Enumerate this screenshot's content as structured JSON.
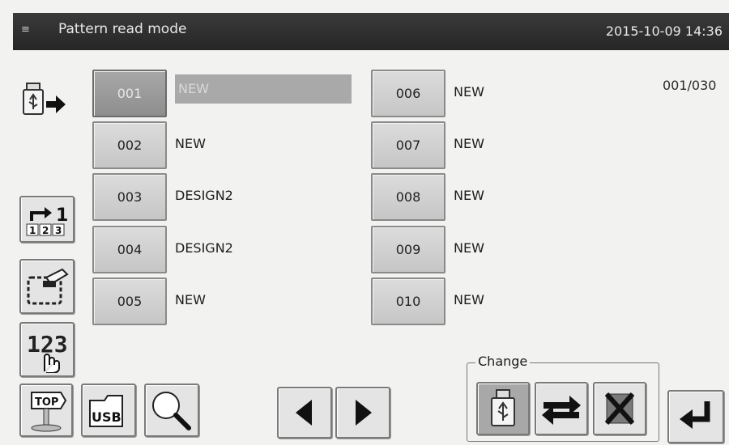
{
  "header": {
    "title": "Pattern read mode",
    "datetime": "2015-10-09 14:36"
  },
  "counter": "001/030",
  "patterns": [
    {
      "number": "001",
      "name": "NEW",
      "selected": true
    },
    {
      "number": "002",
      "name": "NEW"
    },
    {
      "number": "003",
      "name": "DESIGN2"
    },
    {
      "number": "004",
      "name": "DESIGN2"
    },
    {
      "number": "005",
      "name": "NEW"
    },
    {
      "number": "006",
      "name": "NEW"
    },
    {
      "number": "007",
      "name": "NEW"
    },
    {
      "number": "008",
      "name": "NEW"
    },
    {
      "number": "009",
      "name": "NEW"
    },
    {
      "number": "010",
      "name": "NEW"
    }
  ],
  "toolbar": {
    "top_label": "TOP",
    "usb_label": "USB"
  },
  "change": {
    "label": "Change"
  },
  "icons": {
    "usb_read": "usb-arrow-icon",
    "number_order": "arrow-123-icon",
    "copy": "copy-pattern-icon",
    "number_touch": "123-hand-icon",
    "top": "top-sign-icon",
    "usb": "usb-folder-icon",
    "search": "magnifier-icon",
    "prev": "triangle-left-icon",
    "next": "triangle-right-icon",
    "change_usb": "usb-drive-icon",
    "change_swap": "swap-arrows-icon",
    "change_delete": "delete-x-icon",
    "enter": "enter-return-icon"
  },
  "colors": {
    "header_bg": "#2e2e2e",
    "selected": "#9a9a9a",
    "button": "#d2d2d2"
  }
}
